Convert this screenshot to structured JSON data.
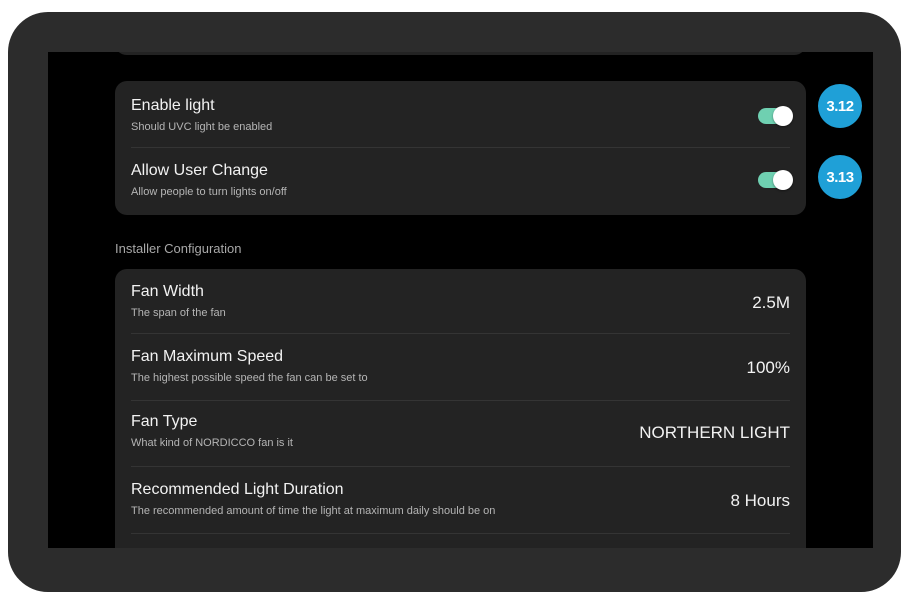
{
  "lights_card": {
    "rows": [
      {
        "title": "Enable light",
        "subtitle": "Should UVC light be enabled",
        "toggle_on": true
      },
      {
        "title": "Allow User Change",
        "subtitle": "Allow people to turn lights on/off",
        "toggle_on": true
      }
    ]
  },
  "installer_section": {
    "label": "Installer Configuration",
    "rows": [
      {
        "title": "Fan Width",
        "subtitle": "The span of the fan",
        "value": "2.5M"
      },
      {
        "title": "Fan Maximum Speed",
        "subtitle": "The highest possible speed the fan can be set to",
        "value": "100%"
      },
      {
        "title": "Fan Type",
        "subtitle": "What kind of NORDICCO fan is it",
        "value": "NORTHERN LIGHT"
      },
      {
        "title": "Recommended Light Duration",
        "subtitle": "The recommended amount of time the light at maximum daily should be on",
        "value": "8 Hours"
      }
    ]
  },
  "annotations": [
    {
      "label": "3.12"
    },
    {
      "label": "3.13"
    }
  ],
  "colors": {
    "toggle_on": "#6fd0b1",
    "badge": "#1fa0d7",
    "card": "#232323",
    "bezel": "#2c2c2c"
  }
}
